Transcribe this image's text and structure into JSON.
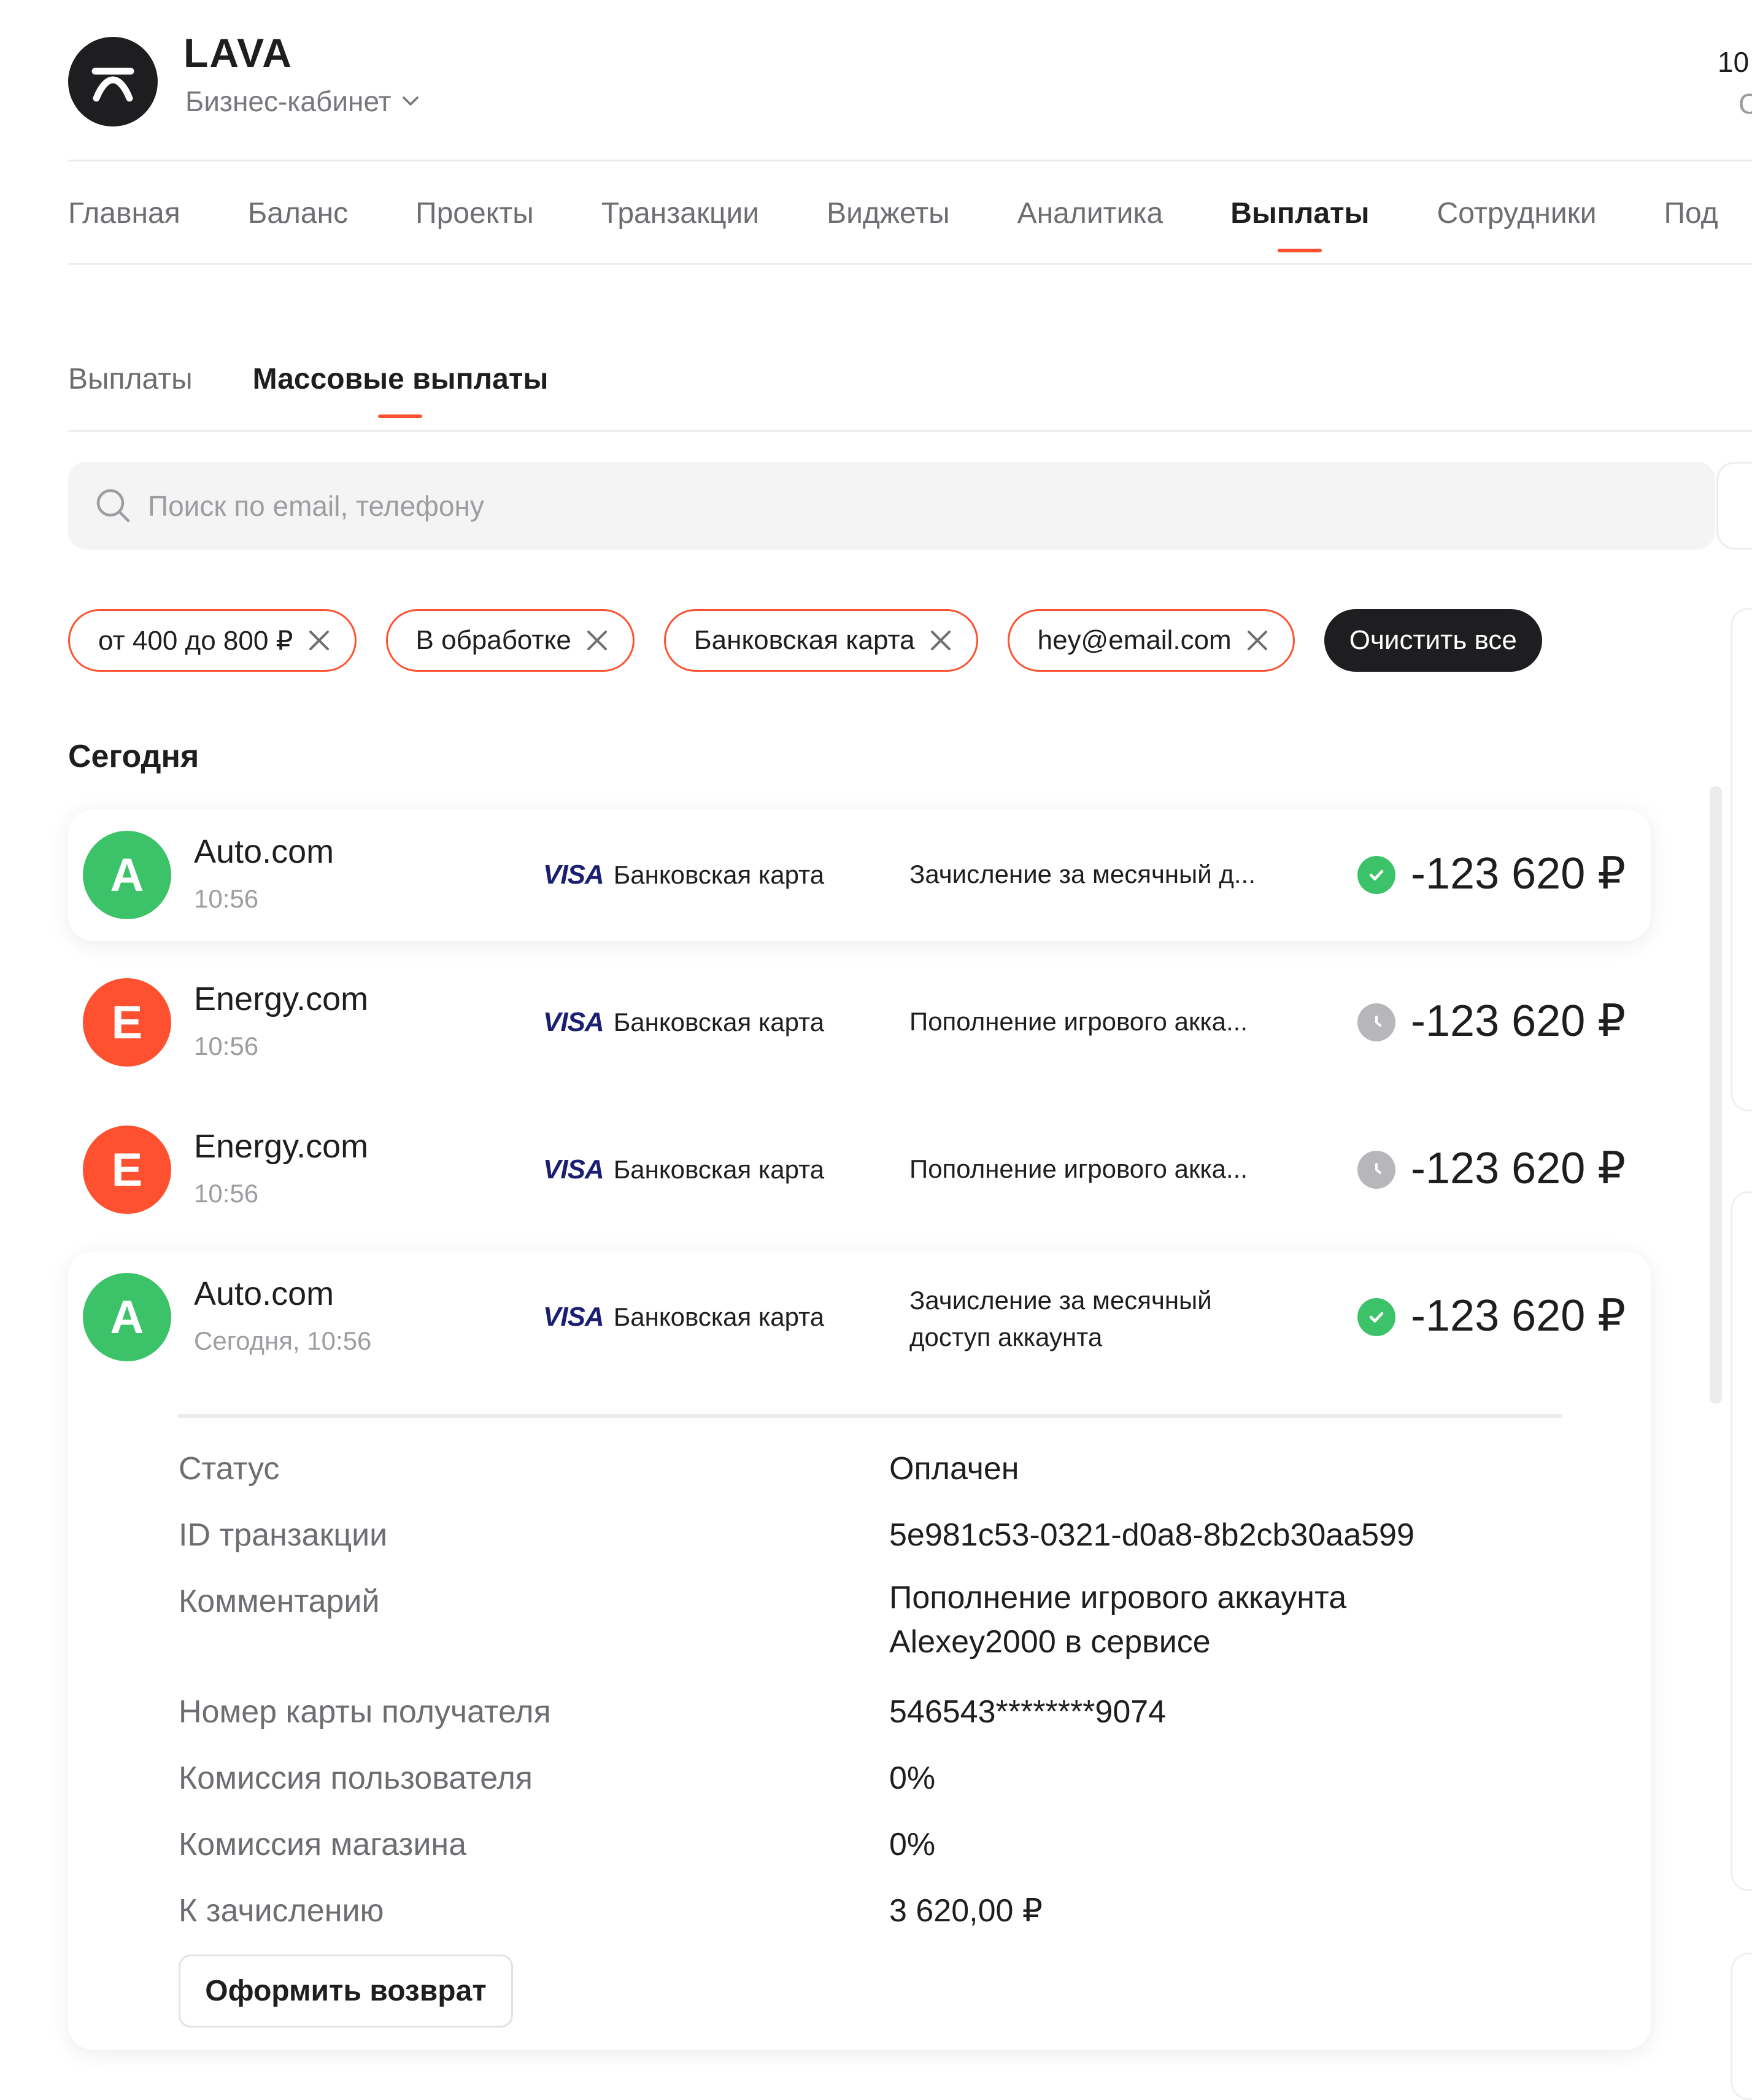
{
  "header": {
    "brand_name": "LAVA",
    "cabinet_label": "Бизнес-кабинет",
    "right_top": "10",
    "right_bottom": "С"
  },
  "nav": {
    "items": [
      {
        "label": "Главная"
      },
      {
        "label": "Баланс"
      },
      {
        "label": "Проекты"
      },
      {
        "label": "Транзакции"
      },
      {
        "label": "Виджеты"
      },
      {
        "label": "Аналитика"
      },
      {
        "label": "Выплаты",
        "active": true
      },
      {
        "label": "Сотрудники"
      },
      {
        "label": "Под"
      }
    ]
  },
  "subtabs": {
    "items": [
      {
        "label": "Выплаты"
      },
      {
        "label": "Массовые выплаты",
        "active": true
      }
    ]
  },
  "search": {
    "placeholder": "Поиск по email, телефону"
  },
  "filters": {
    "chips": [
      {
        "label": "от 400 до 800 ₽"
      },
      {
        "label": "В обработке"
      },
      {
        "label": "Банковская карта"
      },
      {
        "label": "hey@email.com"
      }
    ],
    "clear_label": "Очистить все"
  },
  "section_title": "Сегодня",
  "payouts": [
    {
      "initial": "A",
      "merchant": "Auto.com",
      "time": "10:56",
      "card_brand": "VISA",
      "method": "Банковская карта",
      "description": "Зачисление за месячный д...",
      "status": "success",
      "amount": "-123 620 ₽"
    },
    {
      "initial": "E",
      "merchant": "Energy.com",
      "time": "10:56",
      "card_brand": "VISA",
      "method": "Банковская карта",
      "description": "Пополнение игрового акка...",
      "status": "pending",
      "amount": "-123 620 ₽"
    },
    {
      "initial": "E",
      "merchant": "Energy.com",
      "time": "10:56",
      "card_brand": "VISA",
      "method": "Банковская карта",
      "description": "Пополнение игрового акка...",
      "status": "pending",
      "amount": "-123 620 ₽"
    }
  ],
  "expanded": {
    "initial": "A",
    "merchant": "Auto.com",
    "time": "Сегодня, 10:56",
    "card_brand": "VISA",
    "method": "Банковская карта",
    "description_line1": "Зачисление за месячный",
    "description_line2": "доступ аккаунта",
    "amount": "-123 620 ₽",
    "details": {
      "status_label": "Статус",
      "status_value": "Оплачен",
      "txid_label": "ID транзакции",
      "txid_value": "5e981c53-0321-d0a8-8b2cb30aa599",
      "comment_label": "Комментарий",
      "comment_line1": "Пополнение игрового аккаунта",
      "comment_line2": "Alexey2000 в сервисе",
      "card_label": "Номер карты получателя",
      "card_value": "546543********9074",
      "user_fee_label": "Комиссия пользователя",
      "user_fee_value": "0%",
      "shop_fee_label": "Комиссия магазина",
      "shop_fee_value": "0%",
      "credit_label": "К зачислению",
      "credit_value": "3 620,00 ₽"
    },
    "refund_label": "Оформить возврат"
  },
  "colors": {
    "accent": "#ff5130",
    "success": "#3cc36a",
    "pending": "#b7b7bb",
    "visa": "#1a1f71",
    "dark": "#1e1e20"
  }
}
